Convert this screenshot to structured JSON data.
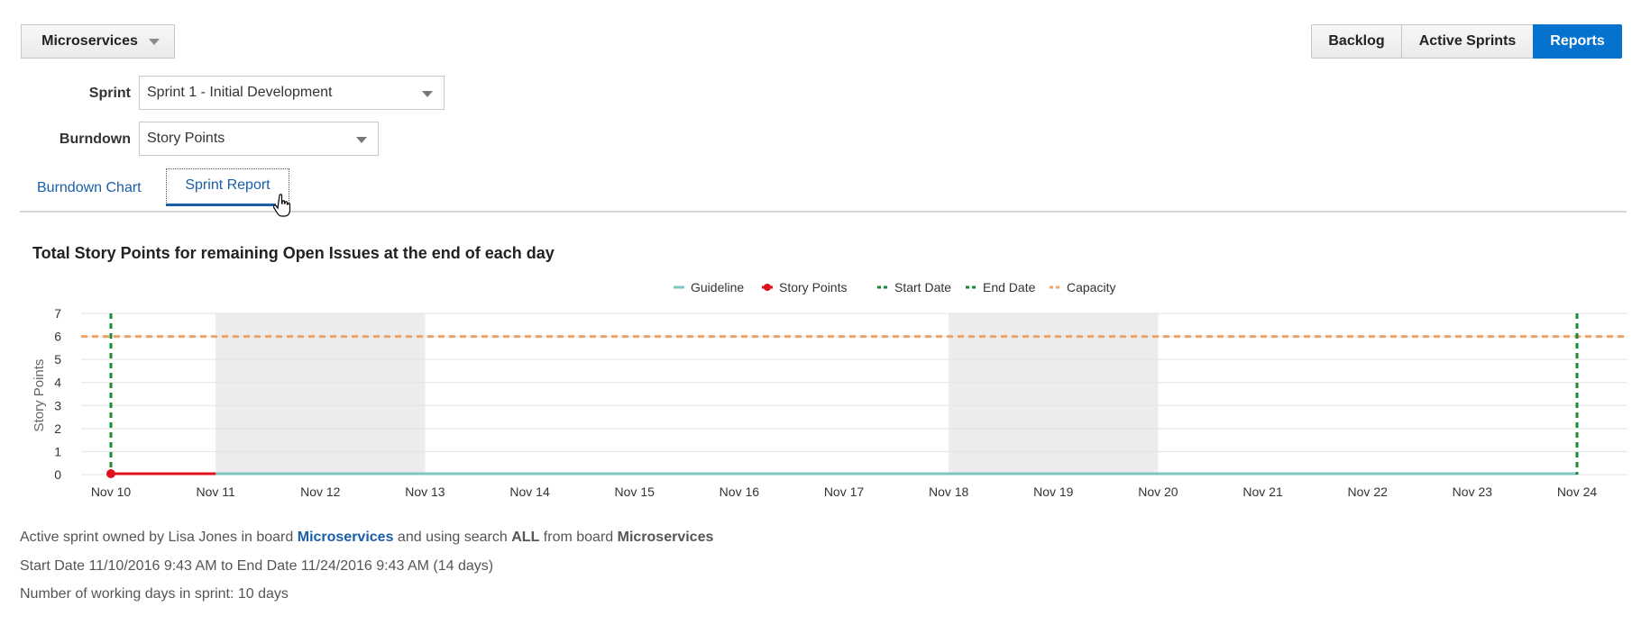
{
  "header": {
    "board_button": "Microservices",
    "nav": {
      "backlog": "Backlog",
      "active_sprints": "Active Sprints",
      "reports": "Reports"
    },
    "accent_color": "#0572ce"
  },
  "filters": {
    "sprint_label": "Sprint",
    "sprint_value": "Sprint 1 - Initial Development",
    "burndown_label": "Burndown",
    "burndown_value": "Story Points"
  },
  "tabs": {
    "burndown_chart": "Burndown Chart",
    "sprint_report": "Sprint Report",
    "selected": "Sprint Report"
  },
  "chart_data": {
    "type": "line",
    "title": "Total Story Points for remaining Open Issues at the end of each day",
    "ylabel": "Story Points",
    "xlabel": "",
    "ylim": [
      0,
      7
    ],
    "yticks": [
      "0",
      "1",
      "2",
      "3",
      "4",
      "5",
      "6",
      "7"
    ],
    "categories": [
      "Nov 10",
      "Nov 11",
      "Nov 12",
      "Nov 13",
      "Nov 14",
      "Nov 15",
      "Nov 16",
      "Nov 17",
      "Nov 18",
      "Nov 19",
      "Nov 20",
      "Nov 21",
      "Nov 22",
      "Nov 23",
      "Nov 24"
    ],
    "legend": [
      {
        "name": "Guideline",
        "color": "#7dc6c0",
        "style": "line"
      },
      {
        "name": "Story Points",
        "color": "#e0111b",
        "style": "line-marker"
      },
      {
        "name": "Start Date",
        "color": "#1a8a35",
        "style": "dashed"
      },
      {
        "name": "End Date",
        "color": "#1a8a35",
        "style": "dashed"
      },
      {
        "name": "Capacity",
        "color": "#f0a464",
        "style": "dashed"
      }
    ],
    "legend_position": "top-center",
    "grid": true,
    "series": [
      {
        "name": "Guideline",
        "x": [
          "Nov 10",
          "Nov 24"
        ],
        "values": [
          0,
          0
        ]
      },
      {
        "name": "Story Points",
        "x": [
          "Nov 10",
          "Nov 11"
        ],
        "values": [
          0,
          0
        ]
      }
    ],
    "start_date": "Nov 10",
    "end_date": "Nov 24",
    "capacity": 6,
    "non_working_bands": [
      [
        "Nov 11",
        "Nov 13"
      ],
      [
        "Nov 18",
        "Nov 20"
      ]
    ]
  },
  "info": {
    "line1": {
      "prefix": "Active sprint owned by Lisa Jones in board",
      "board": "Microservices",
      "mid": "and using search",
      "search": "ALL",
      "mid2": "from board",
      "board2": "Microservices"
    },
    "line2": "Start Date 11/10/2016 9:43 AM to End Date 11/24/2016 9:43 AM (14 days)",
    "line3": "Number of working days in sprint: 10 days"
  }
}
